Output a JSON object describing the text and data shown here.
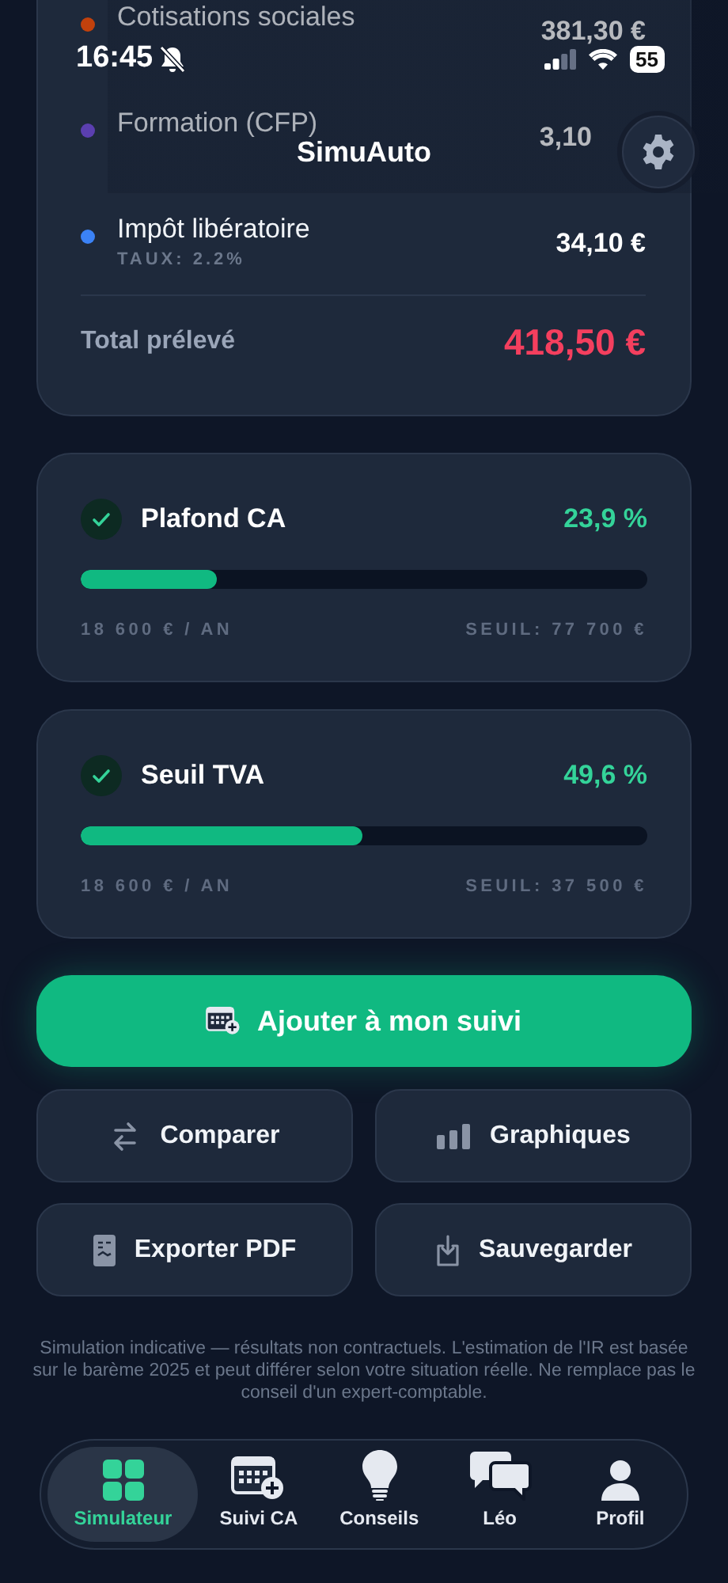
{
  "status_bar": {
    "time": "16:45",
    "battery": "55"
  },
  "header": {
    "title": "SimuAuto"
  },
  "breakdown": {
    "rows": [
      {
        "name": "Cotisations sociales",
        "amount": "381,30 €",
        "color": "#c2410c"
      },
      {
        "name": "Formation (CFP)",
        "amount": "3,10",
        "color": "#5b3fb0"
      },
      {
        "name": "Impôt libératoire",
        "rate": "TAUX: 2.2%",
        "amount": "34,10 €",
        "color": "#3b82f6"
      }
    ],
    "total_label": "Total prélevé",
    "total": "418,50 €"
  },
  "gauges": [
    {
      "title": "Plafond CA",
      "percent": "23,9 %",
      "level": 0.239,
      "left": "18 600 € / AN",
      "right": "SEUIL: 77 700 €"
    },
    {
      "title": "Seuil TVA",
      "percent": "49,6 %",
      "level": 0.496,
      "left": "18 600 € / AN",
      "right": "SEUIL: 37 500 €"
    }
  ],
  "primary_button": "Ajouter à mon suivi",
  "actions": [
    {
      "label": "Comparer",
      "kind": "compare"
    },
    {
      "label": "Graphiques",
      "kind": "chart"
    },
    {
      "label": "Exporter PDF",
      "kind": "document"
    },
    {
      "label": "Sauvegarder",
      "kind": "save"
    }
  ],
  "disclaimer": "Simulation indicative — résultats non contractuels. L'estimation de l'IR est basée sur le barème 2025 et peut différer selon votre situation réelle. Ne remplace pas le conseil d'un expert-comptable.",
  "tabs": [
    {
      "label": "Simulateur",
      "kind": "grid",
      "selected": true
    },
    {
      "label": "Suivi CA",
      "kind": "calendar",
      "selected": false
    },
    {
      "label": "Conseils",
      "kind": "bulb",
      "selected": false
    },
    {
      "label": "Léo",
      "kind": "chat",
      "selected": false
    },
    {
      "label": "Profil",
      "kind": "person",
      "selected": false
    }
  ]
}
